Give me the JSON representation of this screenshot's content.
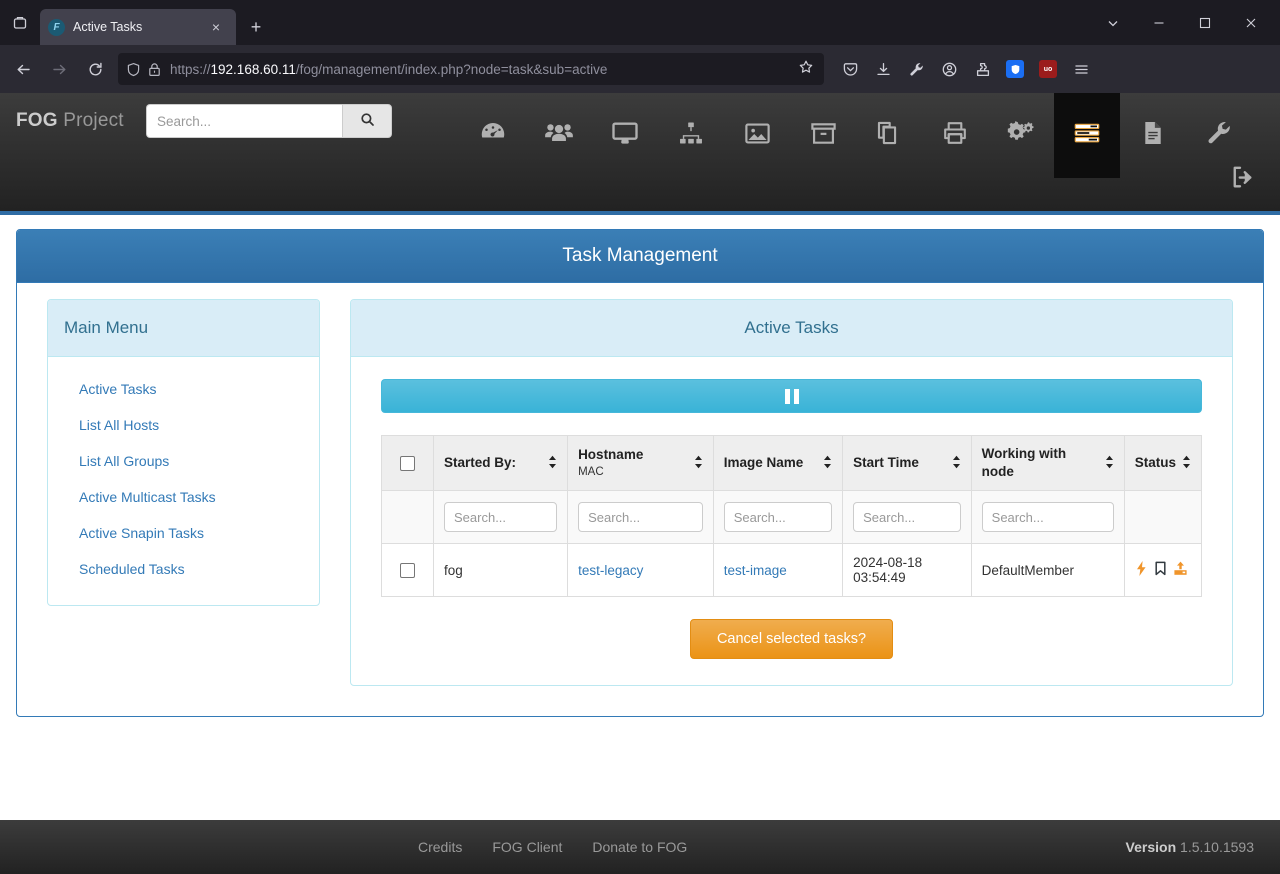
{
  "browser": {
    "tab": {
      "title": "Active Tasks",
      "favicon_letter": "F",
      "favicon_name": "fog-favicon"
    },
    "new_tab_label": "+",
    "close_label": "×",
    "url": {
      "scheme": "https://",
      "host": "192.168.60.11",
      "path": "/fog/management/index.php?node=task&sub=active"
    },
    "toolbar_icons": [
      "shield-icon",
      "download-icon",
      "wrench-icon",
      "account-icon",
      "extensions-icon",
      "bitwarden-extension-icon",
      "ublock-extension-icon",
      "app-menu-icon"
    ],
    "nav_icons": [
      "back-icon",
      "forward-icon",
      "reload-icon"
    ],
    "window_controls": [
      "tab-list-chevron",
      "minimize",
      "maximize",
      "close"
    ]
  },
  "fog_nav": {
    "brand_bold": "FOG",
    "brand_rest": " Project",
    "search_placeholder": "Search...",
    "search_value": "",
    "search_button_icon": "search-icon",
    "logout_icon": "logout-icon",
    "items": [
      {
        "name": "dashboard",
        "icon": "dashboard-gauge-icon",
        "active": false
      },
      {
        "name": "users",
        "icon": "users-group-icon",
        "active": false
      },
      {
        "name": "hosts",
        "icon": "desktop-monitor-icon",
        "active": false
      },
      {
        "name": "groups",
        "icon": "sitemap-icon",
        "active": false
      },
      {
        "name": "images",
        "icon": "picture-icon",
        "active": false
      },
      {
        "name": "storage",
        "icon": "archive-box-icon",
        "active": false
      },
      {
        "name": "snapins",
        "icon": "clone-copy-icon",
        "active": false
      },
      {
        "name": "printers",
        "icon": "printer-icon",
        "active": false
      },
      {
        "name": "services",
        "icon": "gears-icon",
        "active": false
      },
      {
        "name": "tasks",
        "icon": "tasks-list-icon",
        "active": true
      },
      {
        "name": "reports",
        "icon": "file-document-icon",
        "active": false
      },
      {
        "name": "settings",
        "icon": "wrench-icon",
        "active": false
      }
    ]
  },
  "page": {
    "title": "Task Management"
  },
  "sidebar": {
    "title": "Main Menu",
    "items": [
      {
        "label": "Active Tasks"
      },
      {
        "label": "List All Hosts"
      },
      {
        "label": "List All Groups"
      },
      {
        "label": "Active Multicast Tasks"
      },
      {
        "label": "Active Snapin Tasks"
      },
      {
        "label": "Scheduled Tasks"
      }
    ]
  },
  "tasks_panel": {
    "title": "Active Tasks",
    "pause_button": {
      "icon": "pause-icon",
      "label": ""
    },
    "cancel_button": {
      "label": "Cancel selected tasks?"
    },
    "table": {
      "select_all_checkbox": false,
      "columns": [
        {
          "label": "Started By:",
          "sub": "",
          "sortable": true,
          "filter_placeholder": "Search..."
        },
        {
          "label": "Hostname",
          "sub": "MAC",
          "sortable": true,
          "filter_placeholder": "Search..."
        },
        {
          "label": "Image Name",
          "sub": "",
          "sortable": true,
          "filter_placeholder": "Search..."
        },
        {
          "label": "Start Time",
          "sub": "",
          "sortable": true,
          "filter_placeholder": "Search..."
        },
        {
          "label": "Working with node",
          "sub": "",
          "sortable": true,
          "filter_placeholder": "Search..."
        },
        {
          "label": "Status",
          "sub": "",
          "sortable": true,
          "filter_placeholder": ""
        }
      ],
      "rows": [
        {
          "checked": false,
          "started_by": "fog",
          "hostname": "test-legacy",
          "image_name": "test-image",
          "start_time": "2024-08-18 03:54:49",
          "node": "DefaultMember",
          "status_icons": [
            "lightning-bolt-icon",
            "bookmark-flag-icon",
            "upload-export-icon"
          ]
        }
      ]
    }
  },
  "footer": {
    "links": [
      {
        "label": "Credits"
      },
      {
        "label": "FOG Client"
      },
      {
        "label": "Donate to FOG"
      }
    ],
    "version_label": "Version",
    "version_value": "1.5.10.1593"
  },
  "colors": {
    "panel_header_blue": "#2e6da4",
    "info_light_blue": "#d9edf7",
    "link_blue": "#337ab7",
    "accent_orange": "#f0ad4e",
    "pause_cyan": "#39b3d7",
    "chrome_dark": "#1c1b22"
  }
}
